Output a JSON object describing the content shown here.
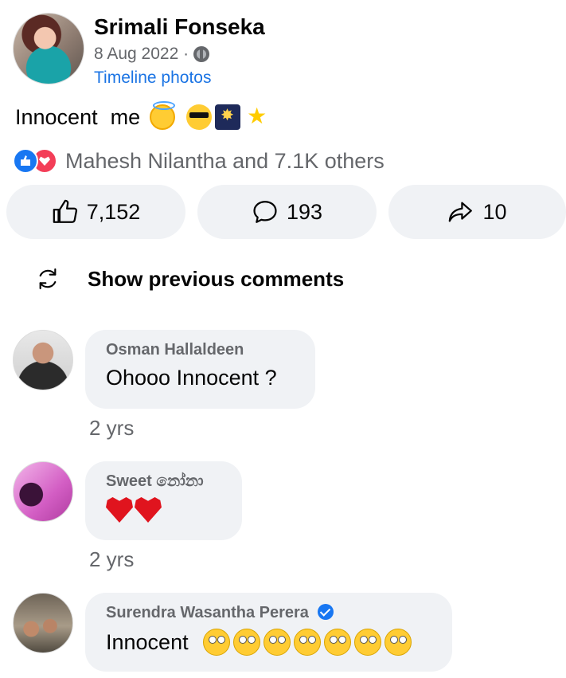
{
  "post": {
    "author": "Srimali Fonseka",
    "date": "8 Aug 2022 ·",
    "album": "Timeline photos",
    "text_words": [
      "Innocent",
      "me"
    ],
    "emojis": [
      "halo-face-emoji",
      "sunglasses-face-emoji",
      "fireworks-emoji",
      "shooting-star-emoji"
    ]
  },
  "reactions": {
    "icons": [
      "like-reaction-icon",
      "love-reaction-icon"
    ],
    "summary": "Mahesh Nilantha and 7.1K others"
  },
  "actions": {
    "like_count": "7,152",
    "comment_count": "193",
    "share_count": "10"
  },
  "comments_section": {
    "show_previous_label": "Show previous comments"
  },
  "comments": [
    {
      "name": "Osman Hallaldeen",
      "text": "Ohooo Innocent ?",
      "time": "2 yrs",
      "verified": false
    },
    {
      "name": "Sweet නෝනා",
      "text": "",
      "hearts": 2,
      "time": "2 yrs",
      "verified": false
    },
    {
      "name": "Surendra Wasantha Perera",
      "text": "Innocent",
      "roll_eyes": 7,
      "verified": true
    }
  ],
  "colors": {
    "link": "#1b74e4",
    "secondary_text": "#65676b",
    "pill_bg": "#f0f2f5",
    "like_blue": "#1877f2",
    "love_red": "#f33e58"
  }
}
